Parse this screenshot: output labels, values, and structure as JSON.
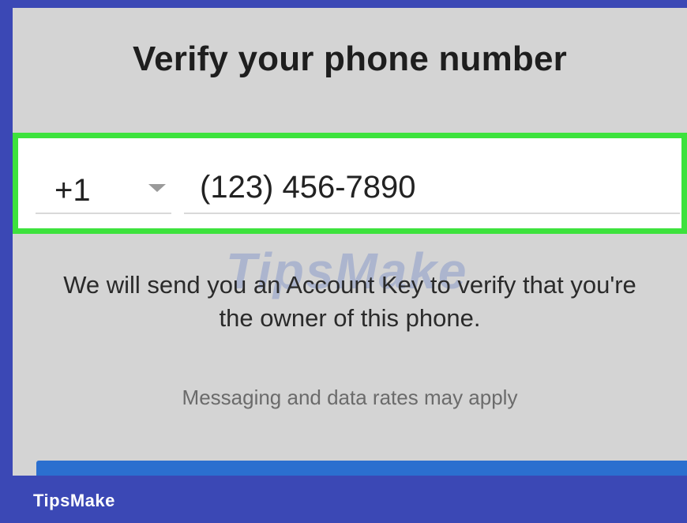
{
  "dialog": {
    "title": "Verify your phone number",
    "country_code": "+1",
    "phone_number": "(123) 456-7890",
    "info_text": "We will send you an Account Key to verify that you're the owner of this phone.",
    "rates_text": "Messaging and data rates may apply"
  },
  "watermark": {
    "text": "TipsMake"
  },
  "brand": {
    "label": "TipsMake"
  },
  "colors": {
    "frame": "#3b48b5",
    "background": "#d4d4d4",
    "highlight": "#3de23d",
    "button": "#2b6fcf"
  },
  "icons": {
    "dropdown": "chevron-down-icon"
  }
}
